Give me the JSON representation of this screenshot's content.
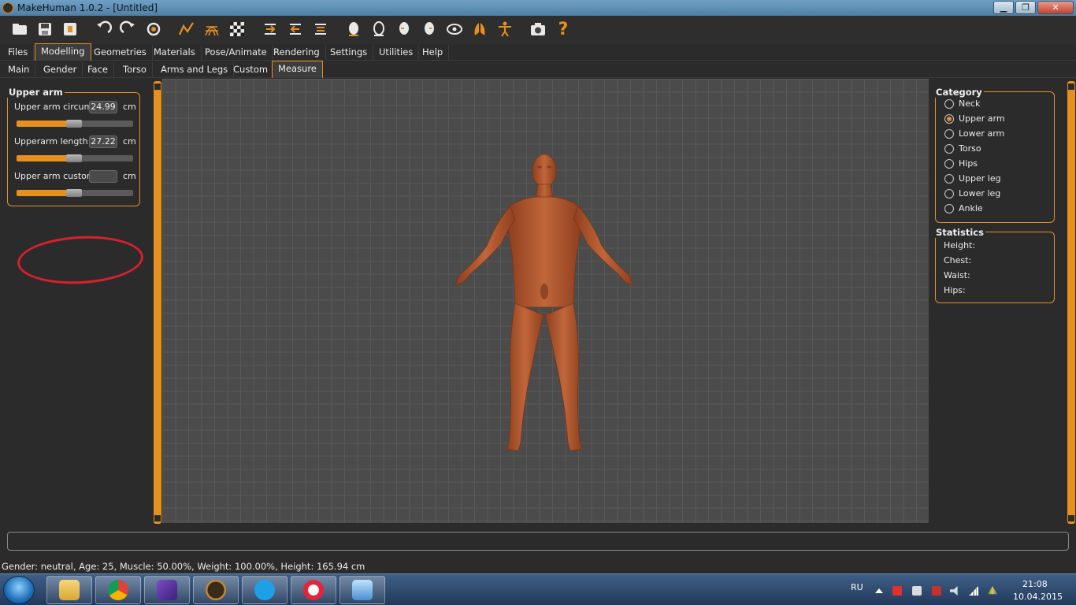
{
  "window": {
    "title": "MakeHuman 1.0.2 - [Untitled]",
    "minimize": "▁",
    "maximize": "❐",
    "close": "✕"
  },
  "toolbar": {
    "icons": [
      "folder-icon",
      "save-icon",
      "export-icon",
      "undo-icon",
      "redo-icon",
      "reset-icon",
      "smooth-icon",
      "wireframe-icon",
      "background-icon",
      "front-view-icon",
      "back-view-icon",
      "left-view-icon",
      "right-view-icon",
      "top-view-icon",
      "bottom-view-icon",
      "reset-camera-icon",
      "pose-icon",
      "symmetry-icon",
      "screenshot-icon",
      "help-icon"
    ],
    "help_label": "?"
  },
  "tabs": {
    "main": [
      "Files",
      "Modelling",
      "Geometries",
      "Materials",
      "Pose/Animate",
      "Rendering",
      "Settings",
      "Utilities",
      "Help"
    ],
    "main_active": "Modelling",
    "sub": [
      "Main",
      "Gender",
      "Face",
      "Torso",
      "Arms and Legs",
      "Custom",
      "Measure"
    ],
    "sub_active": "Measure"
  },
  "left": {
    "group_title": "Upper arm",
    "sliders": [
      {
        "label": "Upper arm circum",
        "value": "24.99",
        "unit": "cm",
        "level": 0.48
      },
      {
        "label": "Upperarm length",
        "value": "27.22",
        "unit": "cm",
        "level": 0.48
      },
      {
        "label": "Upper arm custom",
        "value": "",
        "unit": "cm",
        "level": 0.48
      }
    ]
  },
  "right": {
    "category_title": "Category",
    "categories": [
      "Neck",
      "Upper arm",
      "Lower arm",
      "Torso",
      "Hips",
      "Upper leg",
      "Lower leg",
      "Ankle"
    ],
    "selected": "Upper arm",
    "statistics_title": "Statistics",
    "statistics": [
      "Height:",
      "Chest:",
      "Waist:",
      "Hips:"
    ]
  },
  "status": {
    "line": "Gender: neutral, Age: 25, Muscle: 50.00%, Weight: 100.00%, Height: 165.94 cm"
  },
  "taskbar": {
    "apps": [
      "explorer-icon",
      "chrome-icon",
      "pen-app-icon",
      "makehuman-icon",
      "skype-icon",
      "itunes-icon",
      "remote-desktop-icon"
    ],
    "language": "RU",
    "time": "21:08",
    "date": "10.04.2015"
  },
  "colors": {
    "accent": "#e8901e",
    "skin": "#b5582e",
    "viewport_bg": "#4b4b4b"
  }
}
